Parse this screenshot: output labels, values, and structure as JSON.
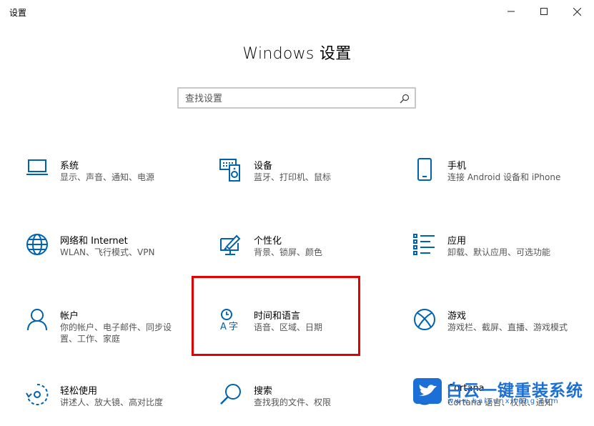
{
  "window": {
    "title": "设置"
  },
  "page": {
    "title": "Windows 设置"
  },
  "search": {
    "placeholder": "查找设置"
  },
  "tiles": [
    {
      "name": "系统",
      "desc": "显示、声音、通知、电源",
      "icon": "laptop-icon"
    },
    {
      "name": "设备",
      "desc": "蓝牙、打印机、鼠标",
      "icon": "keyboard-device-icon"
    },
    {
      "name": "手机",
      "desc": "连接 Android 设备和 iPhone",
      "icon": "phone-icon"
    },
    {
      "name": "网络和 Internet",
      "desc": "WLAN、飞行模式、VPN",
      "icon": "globe-icon"
    },
    {
      "name": "个性化",
      "desc": "背景、锁屏、颜色",
      "icon": "paint-brush-icon"
    },
    {
      "name": "应用",
      "desc": "卸载、默认应用、可选功能",
      "icon": "apps-list-icon"
    },
    {
      "name": "帐户",
      "desc": "你的帐户、电子邮件、同步设置、工作、家庭",
      "icon": "person-icon"
    },
    {
      "name": "时间和语言",
      "desc": "语音、区域、日期",
      "icon": "time-language-icon"
    },
    {
      "name": "游戏",
      "desc": "游戏栏、截屏、直播、游戏模式",
      "icon": "xbox-icon"
    },
    {
      "name": "轻松使用",
      "desc": "讲述人、放大镜、高对比度",
      "icon": "ease-of-access-icon"
    },
    {
      "name": "搜索",
      "desc": "查找我的文件、权限",
      "icon": "search-icon"
    },
    {
      "name": "Cortana",
      "desc": "Cortana 语言、权限、通知",
      "icon": "cortana-icon"
    }
  ],
  "watermark": {
    "text": "白云一键重装系统",
    "url": "www.baiyunxitong.com"
  },
  "colors": {
    "accent": "#0063b1",
    "highlight": "#e30000"
  }
}
